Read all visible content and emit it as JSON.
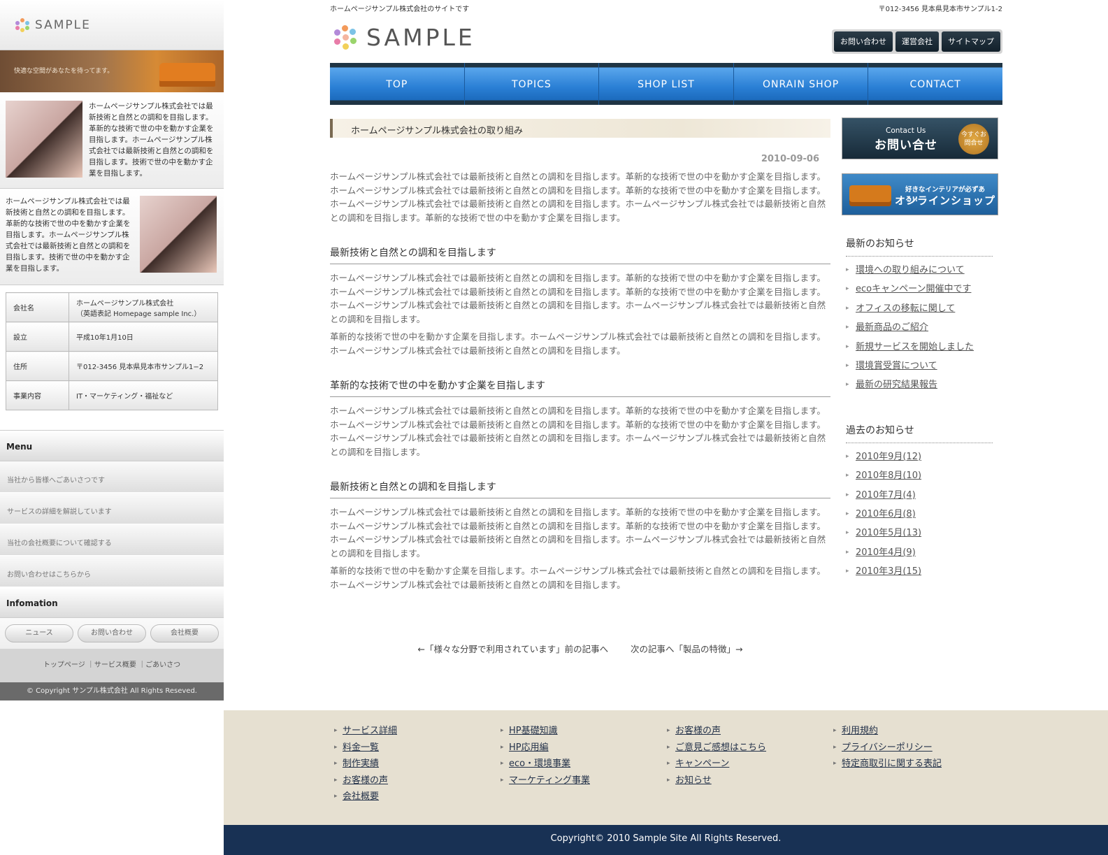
{
  "side": {
    "logo": "SAMPLE",
    "banner_text": "快適な空間があなたを待ってます。",
    "profile1": "ホームページサンプル株式会社では最新技術と自然との調和を目指します。革新的な技術で世の中を動かす企業を目指します。ホームページサンプル株式会社では最新技術と自然との調和を目指します。技術で世の中を動かす企業を目指します。",
    "profile2": "ホームページサンプル株式会社では最新技術と自然との調和を目指します。革新的な技術で世の中を動かす企業を目指します。ホームページサンプル株式会社では最新技術と自然との調和を目指します。技術で世の中を動かす企業を目指します。",
    "company": [
      {
        "label": "会社名",
        "value": "ホームページサンプル株式会社",
        "value2": "（英語表記 Homepage sample Inc.）"
      },
      {
        "label": "設立",
        "value": "平成10年1月10日",
        "value2": ""
      },
      {
        "label": "住所",
        "value": "〒012-3456 見本県見本市サンプル1−2",
        "value2": ""
      },
      {
        "label": "事業内容",
        "value": "IT・マーケティング・福祉など",
        "value2": ""
      }
    ],
    "menu_title": "Menu",
    "menu": [
      "当社から皆様へごあいさつです",
      "サービスの詳細を解説しています",
      "当社の会社概要について確認する",
      "お問い合わせはこちらから"
    ],
    "info_title": "Infomation",
    "pills": [
      "ニュース",
      "お問い合わせ",
      "会社概要"
    ],
    "links": "トップページ ｜サービス概要 ｜ごあいさつ",
    "copyright": "© Copyright サンプル株式会社 All Rights Reseved."
  },
  "header": {
    "tagline": "ホームページサンプル株式会社のサイトです",
    "address": "〒012-3456 見本県見本市サンプル1-2",
    "logo": "SAMPLE",
    "buttons": [
      "お問い合わせ",
      "運営会社",
      "サイトマップ"
    ]
  },
  "nav": [
    "TOP",
    "TOPICS",
    "SHOP LIST",
    "ONRAIN SHOP",
    "CONTACT"
  ],
  "article": {
    "title": "ホームページサンプル株式会社の取り組み",
    "date": "2010-09-06",
    "p1": "ホームページサンプル株式会社では最新技術と自然との調和を目指します。革新的な技術で世の中を動かす企業を目指します。ホームページサンプル株式会社では最新技術と自然との調和を目指します。革新的な技術で世の中を動かす企業を目指します。ホームページサンプル株式会社では最新技術と自然との調和を目指します。ホームページサンプル株式会社では最新技術と自然との調和を目指します。革新的な技術で世の中を動かす企業を目指します。",
    "h1": "最新技術と自然との調和を目指します",
    "p2": "ホームページサンプル株式会社では最新技術と自然との調和を目指します。革新的な技術で世の中を動かす企業を目指します。ホームページサンプル株式会社では最新技術と自然との調和を目指します。革新的な技術で世の中を動かす企業を目指します。ホームページサンプル株式会社では最新技術と自然との調和を目指します。ホームページサンプル株式会社では最新技術と自然との調和を目指します。",
    "p3": "革新的な技術で世の中を動かす企業を目指します。ホームページサンプル株式会社では最新技術と自然との調和を目指します。ホームページサンプル株式会社では最新技術と自然との調和を目指します。",
    "h2": "革新的な技術で世の中を動かす企業を目指します",
    "p4": "ホームページサンプル株式会社では最新技術と自然との調和を目指します。革新的な技術で世の中を動かす企業を目指します。ホームページサンプル株式会社では最新技術と自然との調和を目指します。革新的な技術で世の中を動かす企業を目指します。ホームページサンプル株式会社では最新技術と自然との調和を目指します。ホームページサンプル株式会社では最新技術と自然との調和を目指します。",
    "h3": "最新技術と自然との調和を目指します",
    "p5": "ホームページサンプル株式会社では最新技術と自然との調和を目指します。革新的な技術で世の中を動かす企業を目指します。ホームページサンプル株式会社では最新技術と自然との調和を目指します。革新的な技術で世の中を動かす企業を目指します。ホームページサンプル株式会社では最新技術と自然との調和を目指します。ホームページサンプル株式会社では最新技術と自然との調和を目指します。",
    "p6": "革新的な技術で世の中を動かす企業を目指します。ホームページサンプル株式会社では最新技術と自然との調和を目指します。ホームページサンプル株式会社では最新技術と自然との調和を目指します。",
    "prev_pre": "←「",
    "prev_link": "様々な分野で利用されています",
    "prev_post": "」前の記事へ",
    "next_pre": "次の記事へ「",
    "next_link": "製品の特徴",
    "next_post": "」→"
  },
  "right": {
    "contact_en": "Contact Us",
    "contact_jp": "お問い合せ",
    "contact_badge": "今すぐお問合せ",
    "shop_sub": "好きなインテリアが必ずある!!",
    "shop_main": "オンラインショップ",
    "news_title": "最新のお知らせ",
    "news": [
      "環境への取り組みについて",
      "ecoキャンペーン開催中です",
      "オフィスの移転に関して",
      "最新商品のご紹介",
      "新規サービスを開始しました",
      "環境賞受賞について",
      "最新の研究結果報告"
    ],
    "past_title": "過去のお知らせ",
    "past": [
      "2010年9月(12)",
      "2010年8月(10)",
      "2010年7月(4)",
      "2010年6月(8)",
      "2010年5月(13)",
      "2010年4月(9)",
      "2010年3月(15)"
    ]
  },
  "footer": {
    "col1": [
      "サービス詳細",
      "料金一覧",
      "制作実績",
      "お客様の声",
      "会社概要"
    ],
    "col2": [
      "HP基礎知識",
      "HP応用編",
      "eco・環境事業",
      "マーケティング事業"
    ],
    "col3": [
      "お客様の声",
      "ご意見ご感想はこちら",
      "キャンペーン",
      "お知らせ"
    ],
    "col4": [
      "利用規約",
      "プライバシーポリシー",
      "特定商取引に関する表記"
    ],
    "copyright": "Copyright© 2010 Sample Site All Rights Reserved."
  }
}
